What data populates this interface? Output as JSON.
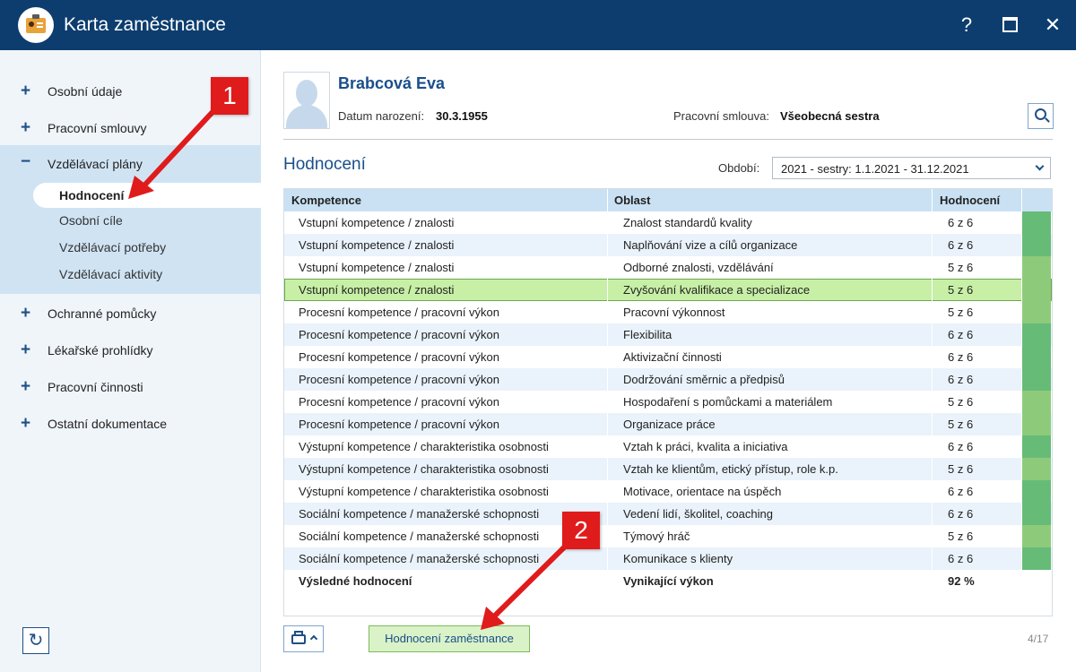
{
  "window": {
    "title": "Karta zaměstnance",
    "help": "?",
    "close": "✕"
  },
  "sidebar": {
    "items": [
      {
        "label": "Osobní údaje",
        "icon": "plus-icon"
      },
      {
        "label": "Pracovní smlouvy",
        "icon": "plus-icon"
      },
      {
        "label": "Vzdělávací plány",
        "icon": "minus-icon"
      },
      {
        "label": "Ochranné pomůcky",
        "icon": "plus-icon"
      },
      {
        "label": "Lékařské prohlídky",
        "icon": "plus-icon"
      },
      {
        "label": "Pracovní činnosti",
        "icon": "plus-icon"
      },
      {
        "label": "Ostatní dokumentace",
        "icon": "plus-icon"
      }
    ],
    "subitems": [
      "Hodnocení",
      "Osobní cíle",
      "Vzdělávací potřeby",
      "Vzdělávací aktivity"
    ],
    "refresh": "↻"
  },
  "employee": {
    "name": "Brabcová Eva",
    "birth_label": "Datum narození:",
    "birth_value": "30.3.1955",
    "contract_label": "Pracovní smlouva:",
    "contract_value": "Všeobecná sestra"
  },
  "section": {
    "title": "Hodnocení",
    "period_label": "Období:",
    "period_value": "2021 - sestry: 1.1.2021 - 31.12.2021"
  },
  "table": {
    "headers": [
      "Kompetence",
      "Oblast",
      "Hodnocení"
    ],
    "rows": [
      {
        "komp": "Vstupní kompetence / znalosti",
        "oblast": "Znalost standardů kvality",
        "hod": "6 z 6",
        "color": "#66bb77"
      },
      {
        "komp": "Vstupní kompetence / znalosti",
        "oblast": "Naplňování vize a cílů organizace",
        "hod": "6 z 6",
        "color": "#66bb77"
      },
      {
        "komp": "Vstupní kompetence / znalosti",
        "oblast": "Odborné znalosti, vzdělávání",
        "hod": "5 z 6",
        "color": "#8dcb7a"
      },
      {
        "komp": "Vstupní kompetence / znalosti",
        "oblast": "Zvyšování kvalifikace a specializace",
        "hod": "5 z 6",
        "color": "#8dcb7a"
      },
      {
        "komp": "Procesní kompetence / pracovní výkon",
        "oblast": "Pracovní výkonnost",
        "hod": "5 z 6",
        "color": "#8dcb7a"
      },
      {
        "komp": "Procesní kompetence / pracovní výkon",
        "oblast": "Flexibilita",
        "hod": "6 z 6",
        "color": "#66bb77"
      },
      {
        "komp": "Procesní kompetence / pracovní výkon",
        "oblast": "Aktivizační činnosti",
        "hod": "6 z 6",
        "color": "#66bb77"
      },
      {
        "komp": "Procesní kompetence / pracovní výkon",
        "oblast": "Dodržování směrnic a předpisů",
        "hod": "6 z 6",
        "color": "#66bb77"
      },
      {
        "komp": "Procesní kompetence / pracovní výkon",
        "oblast": "Hospodaření s pomůckami a materiálem",
        "hod": "5 z 6",
        "color": "#8dcb7a"
      },
      {
        "komp": "Procesní kompetence / pracovní výkon",
        "oblast": "Organizace práce",
        "hod": "5 z 6",
        "color": "#8dcb7a"
      },
      {
        "komp": "Výstupní kompetence / charakteristika osobnosti",
        "oblast": "Vztah k práci, kvalita a iniciativa",
        "hod": "6 z 6",
        "color": "#66bb77"
      },
      {
        "komp": "Výstupní kompetence / charakteristika osobnosti",
        "oblast": "Vztah ke klientům, etický přístup, role k.p.",
        "hod": "5 z 6",
        "color": "#8dcb7a"
      },
      {
        "komp": "Výstupní kompetence / charakteristika osobnosti",
        "oblast": "Motivace, orientace na úspěch",
        "hod": "6 z 6",
        "color": "#66bb77"
      },
      {
        "komp": "Sociální kompetence / manažerské schopnosti",
        "oblast": "Vedení lidí, školitel, coaching",
        "hod": "6 z 6",
        "color": "#66bb77"
      },
      {
        "komp": "Sociální kompetence / manažerské schopnosti",
        "oblast": "Týmový hráč",
        "hod": "5 z 6",
        "color": "#8dcb7a"
      },
      {
        "komp": "Sociální kompetence / manažerské schopnosti",
        "oblast": "Komunikace s klienty",
        "hod": "6 z 6",
        "color": "#66bb77"
      }
    ],
    "total": {
      "komp": "Výsledné hodnocení",
      "oblast": "Vynikající výkon",
      "hod": "92 %"
    }
  },
  "footer": {
    "eval_button": "Hodnocení zaměstnance",
    "pager": "4/17"
  },
  "annotations": {
    "badge1": "1",
    "badge2": "2"
  }
}
